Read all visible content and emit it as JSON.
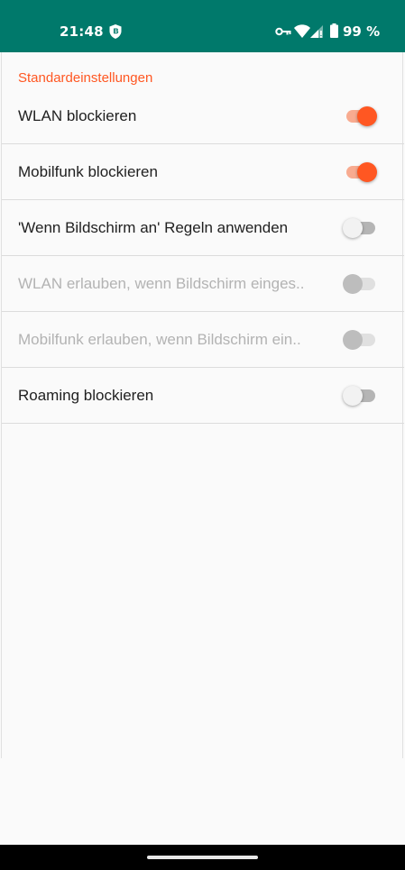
{
  "status_bar": {
    "time": "21:48",
    "battery_text": "99 %",
    "icons": [
      "shield-icon",
      "key-icon",
      "wifi-icon",
      "signal-icon",
      "battery-icon"
    ],
    "background_color": "#00796b"
  },
  "section": {
    "title": "Standardeinstellungen",
    "accent_color": "#ff5722"
  },
  "preferences": [
    {
      "label": "WLAN blockieren",
      "enabled": true,
      "checked": true
    },
    {
      "label": "Mobilfunk blockieren",
      "enabled": true,
      "checked": true
    },
    {
      "label": "'Wenn Bildschirm an' Regeln anwenden",
      "enabled": true,
      "checked": false
    },
    {
      "label": "WLAN erlauben, wenn Bildschirm einges..",
      "enabled": false,
      "checked": false
    },
    {
      "label": "Mobilfunk erlauben, wenn Bildschirm ein..",
      "enabled": false,
      "checked": false
    },
    {
      "label": "Roaming blockieren",
      "enabled": true,
      "checked": false
    }
  ]
}
